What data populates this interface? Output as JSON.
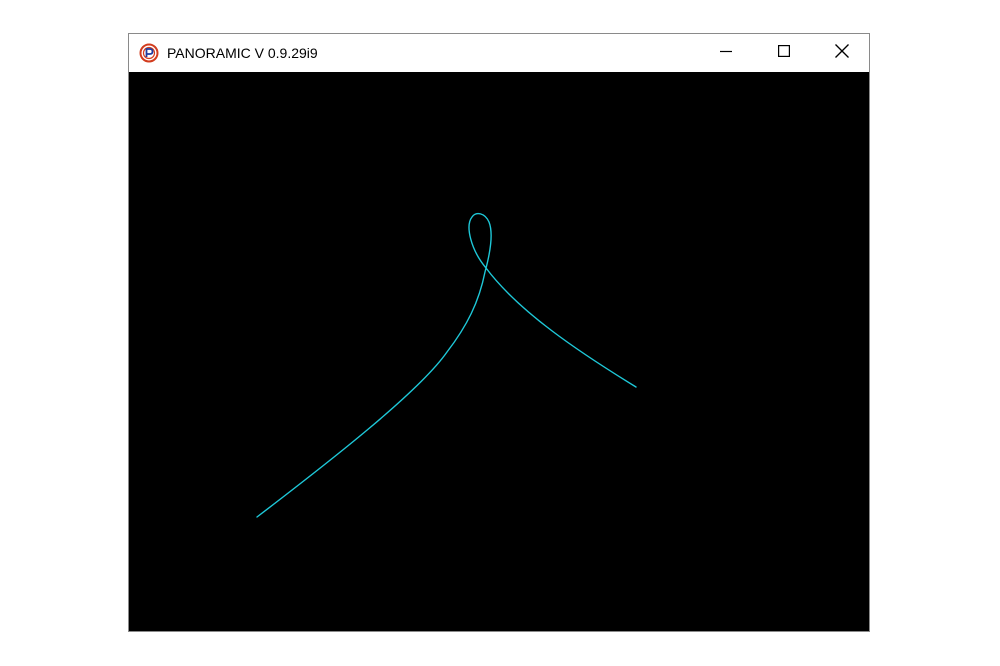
{
  "window": {
    "title": "PANORAMIC V 0.9.29i9",
    "app_icon": "panoramic-logo-icon",
    "controls": {
      "minimize_icon": "minimize-icon",
      "maximize_icon": "maximize-icon",
      "close_icon": "close-icon"
    }
  },
  "canvas": {
    "background": "#000000",
    "curve_color": "#1ec8d8",
    "curve_shape": "thin cyan curve rising from lower left, forming a small loop near the top center, then descending to the right"
  },
  "colors": {
    "titlebar_bg": "#ffffff",
    "title_text": "#000000",
    "icon_red": "#d23c1e",
    "icon_blue": "#1e3ca0"
  }
}
